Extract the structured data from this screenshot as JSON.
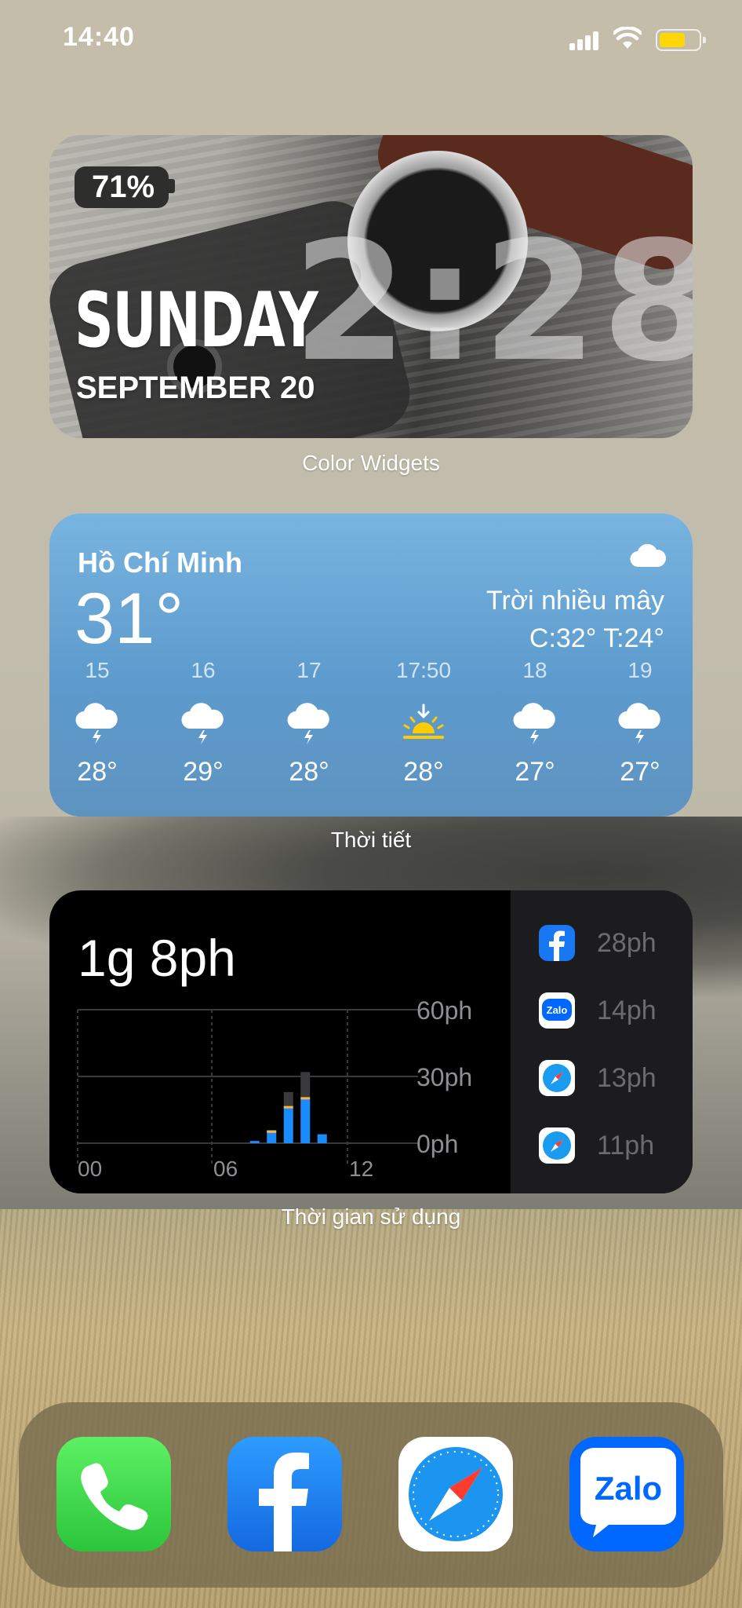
{
  "status_bar": {
    "time": "14:40"
  },
  "color_widget": {
    "battery": "71%",
    "clock": "2:28",
    "day": "SUNDAY",
    "date": "SEPTEMBER 20",
    "caption": "Color Widgets"
  },
  "weather_widget": {
    "city": "Hồ Chí Minh",
    "temperature": "31°",
    "condition": "Trời nhiều mây",
    "high_low": "C:32° T:24°",
    "hours": [
      {
        "label": "15",
        "icon": "thunderstorm-icon",
        "temp": "28°"
      },
      {
        "label": "16",
        "icon": "thunderstorm-icon",
        "temp": "29°"
      },
      {
        "label": "17",
        "icon": "thunderstorm-icon",
        "temp": "28°"
      },
      {
        "label": "17:50",
        "icon": "sunset-icon",
        "temp": "28°"
      },
      {
        "label": "18",
        "icon": "thunderstorm-icon",
        "temp": "27°"
      },
      {
        "label": "19",
        "icon": "thunderstorm-icon",
        "temp": "27°"
      }
    ],
    "caption": "Thời tiết"
  },
  "screen_time_widget": {
    "total": "1g 8ph",
    "y_ticks": [
      "60ph",
      "30ph",
      "0ph"
    ],
    "x_ticks": [
      "00",
      "06",
      "12"
    ],
    "apps": [
      {
        "icon": "facebook-icon",
        "time": "28ph"
      },
      {
        "icon": "zalo-icon",
        "time": "14ph"
      },
      {
        "icon": "safari-icon",
        "time": "13ph"
      },
      {
        "icon": "safari-icon",
        "time": "11ph"
      }
    ],
    "caption": "Thời gian sử dụng",
    "colors": {
      "primary": "#1a8cff",
      "secondary": "#3a3a3c",
      "accent": "#ffb340"
    }
  },
  "chart_data": {
    "type": "bar",
    "x": [
      10,
      11,
      12,
      13,
      14
    ],
    "series": [
      {
        "values": [
          1,
          5,
          16,
          20,
          4
        ]
      },
      {
        "values": [
          0,
          1,
          7,
          12,
          0
        ]
      }
    ],
    "ylim": [
      0,
      60
    ],
    "y_ticks": [
      "60ph",
      "30ph",
      "0ph"
    ],
    "x_ticks": [
      "00",
      "06",
      "12"
    ]
  },
  "dock": {
    "apps": [
      "phone-icon",
      "facebook-icon",
      "safari-icon",
      "zalo-icon"
    ],
    "zalo_label": "Zalo"
  }
}
